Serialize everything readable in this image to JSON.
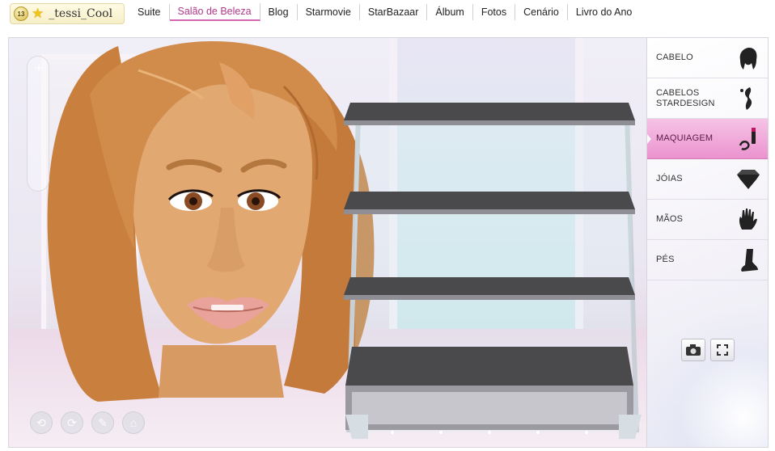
{
  "user": {
    "level": "13",
    "name": "_tessi_Cool"
  },
  "nav": {
    "items": [
      {
        "label": "Suite"
      },
      {
        "label": "Salão de Beleza",
        "active": true
      },
      {
        "label": "Blog"
      },
      {
        "label": "Starmovie"
      },
      {
        "label": "StarBazaar"
      },
      {
        "label": "Álbum"
      },
      {
        "label": "Fotos"
      },
      {
        "label": "Cenário"
      },
      {
        "label": "Livro do Ano"
      }
    ]
  },
  "panel": {
    "categories": [
      {
        "label": "CABELO",
        "icon": "hair-icon"
      },
      {
        "label": "CABELOS STARDESIGN",
        "icon": "hair-design-icon"
      },
      {
        "label": "MAQUIAGEM",
        "icon": "makeup-icon",
        "active": true
      },
      {
        "label": "JÓIAS",
        "icon": "jewel-icon"
      },
      {
        "label": "MÃOS",
        "icon": "hand-icon"
      },
      {
        "label": "PÉS",
        "icon": "foot-icon"
      }
    ],
    "actions": [
      {
        "icon": "camera-icon"
      },
      {
        "icon": "fullscreen-icon"
      }
    ]
  },
  "stage": {
    "shelf_levels": 4,
    "tools": [
      {
        "icon": "rotate-left-icon"
      },
      {
        "icon": "rotate-right-icon"
      },
      {
        "icon": "makeup-brush-icon"
      },
      {
        "icon": "hat-icon"
      }
    ]
  },
  "colors": {
    "accent": "#d266b0",
    "active_tab_bg": "#eb93cf",
    "hair": "#c9803f",
    "skin": "#e2a872",
    "lips": "#e9a39a",
    "shelf": "#4a4a4d"
  }
}
